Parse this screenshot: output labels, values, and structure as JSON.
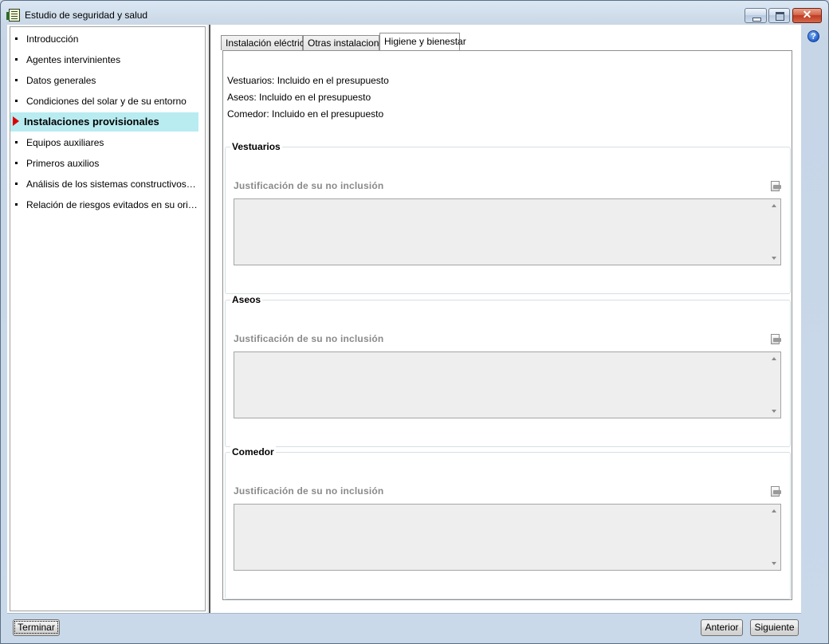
{
  "window": {
    "title": "Estudio de seguridad y salud",
    "close_glyph": "✕"
  },
  "help_label": "?",
  "sidebar": {
    "items": [
      {
        "label": "Introducción"
      },
      {
        "label": "Agentes intervinientes"
      },
      {
        "label": "Datos generales"
      },
      {
        "label": "Condiciones del solar y de su entorno"
      },
      {
        "label": "Instalaciones provisionales",
        "active": true
      },
      {
        "label": "Equipos auxiliares"
      },
      {
        "label": "Primeros auxilios"
      },
      {
        "label": "Análisis de los sistemas constructivos previs..."
      },
      {
        "label": "Relación de riesgos evitados en su origen"
      }
    ]
  },
  "tabs": [
    {
      "label": "Instalación eléctrica"
    },
    {
      "label": "Otras instalaciones"
    },
    {
      "label": "Higiene y bienestar",
      "selected": true
    }
  ],
  "summary": [
    "Vestuarios: Incluido en el presupuesto",
    "Aseos: Incluido en el presupuesto",
    "Comedor: Incluido en el presupuesto"
  ],
  "groups": [
    {
      "title": "Vestuarios",
      "field_label": "Justificación de su no inclusión",
      "value": ""
    },
    {
      "title": "Aseos",
      "field_label": "Justificación de su no inclusión",
      "value": ""
    },
    {
      "title": "Comedor",
      "field_label": "Justificación de su no inclusión",
      "value": ""
    }
  ],
  "buttons": {
    "terminar": "Terminar",
    "anterior": "Anterior",
    "siguiente": "Siguiente"
  }
}
